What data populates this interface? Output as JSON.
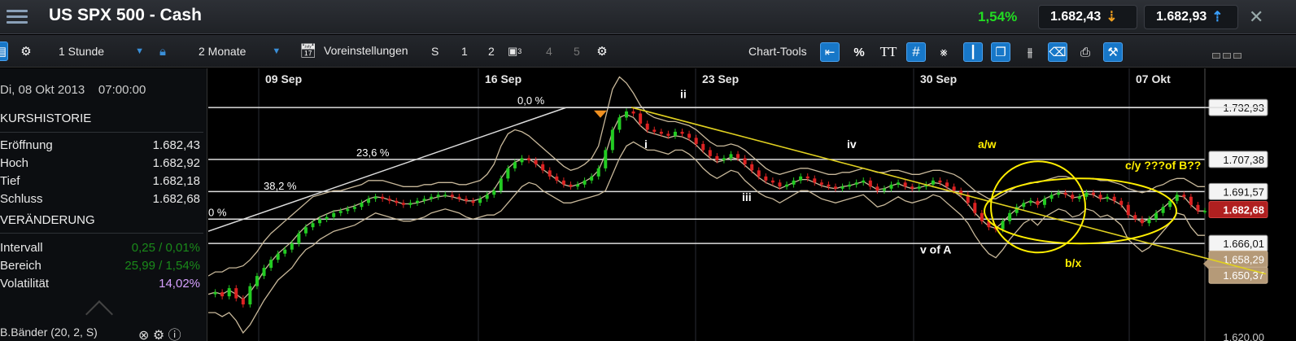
{
  "titlebar": {
    "title": "US SPX 500 - Cash",
    "change": "1,54%",
    "bid": "1.682,43",
    "ask": "1.682,93",
    "icons": [
      "menu-icon",
      "arrow-down-icon",
      "arrow-up-icon",
      "close-icon"
    ]
  },
  "toolbar": {
    "interval": "1 Stunde",
    "range": "2 Monate",
    "presets": "Voreinstellungen",
    "slot_labels": [
      "S",
      "1",
      "2",
      "3",
      "4",
      "5"
    ],
    "chart_tools_label": "Chart-Tools",
    "percent_label": "%",
    "text_label": "TT",
    "icons": [
      "gear-icon",
      "lock-icon",
      "calendar-icon",
      "layout-icon",
      "crosshair-icon",
      "candle-icon",
      "print-icon"
    ]
  },
  "leftpanel": {
    "date": "Di, 08 Okt 2013",
    "time": "07:00:00",
    "kurshistorie": "KURSHISTORIE",
    "rows1": [
      {
        "k": "Eröffnung",
        "v": "1.682,43"
      },
      {
        "k": "Hoch",
        "v": "1.682,92"
      },
      {
        "k": "Tief",
        "v": "1.682,18"
      },
      {
        "k": "Schluss",
        "v": "1.682,68"
      }
    ],
    "veraenderung": "VERÄNDERUNG",
    "rows2": [
      {
        "k": "Intervall",
        "v": "0,25 / 0,01%"
      },
      {
        "k": "Bereich",
        "v": "25,99 / 1,54%"
      },
      {
        "k": "Volatilität",
        "v": "14,02%"
      }
    ],
    "bottom_label": "B.Bänder (20, 2, S)"
  },
  "chart_data": {
    "type": "line",
    "title": "US SPX 500 - Cash",
    "x_ticks": [
      "09 Sep",
      "16 Sep",
      "23 Sep",
      "30 Sep",
      "07 Okt"
    ],
    "y_axis_labels": [
      "1.732,93",
      "1.707,38",
      "1.691,57",
      "1.682,68",
      "1.666,01",
      "1.658,29",
      "1.650,37",
      "1.620,00"
    ],
    "price_levels": [
      1732.93,
      1707.38,
      1691.57,
      1678.0,
      1666.01
    ],
    "current_price": "1.682,68",
    "ylim": [
      1618,
      1745
    ],
    "fib_labels": [
      "0,0 %",
      "23,6 %",
      "38,2 %",
      "0 %"
    ],
    "wave_labels": [
      "i",
      "ii",
      "iii",
      "iv",
      "v of A",
      "a/w",
      "b/x",
      "c/y ???of B??"
    ],
    "price_series": [
      1641,
      1642,
      1640,
      1644,
      1639,
      1636,
      1645,
      1650,
      1654,
      1658,
      1661,
      1663,
      1666,
      1671,
      1674,
      1676,
      1678,
      1679,
      1681,
      1682,
      1683,
      1684,
      1686,
      1688,
      1689,
      1688,
      1687,
      1686,
      1685,
      1686,
      1687,
      1688,
      1689,
      1690,
      1690,
      1689,
      1688,
      1687,
      1686,
      1688,
      1690,
      1692,
      1698,
      1703,
      1706,
      1708,
      1707,
      1705,
      1702,
      1699,
      1697,
      1695,
      1694,
      1695,
      1697,
      1699,
      1703,
      1712,
      1722,
      1728,
      1731,
      1730,
      1725,
      1722,
      1721,
      1720,
      1719,
      1721,
      1720,
      1718,
      1715,
      1712,
      1709,
      1707,
      1708,
      1710,
      1708,
      1705,
      1702,
      1699,
      1697,
      1696,
      1694,
      1695,
      1697,
      1699,
      1698,
      1696,
      1695,
      1694,
      1693,
      1694,
      1695,
      1696,
      1697,
      1694,
      1692,
      1693,
      1695,
      1696,
      1694,
      1693,
      1694,
      1695,
      1697,
      1696,
      1694,
      1692,
      1690,
      1686,
      1681,
      1677,
      1674,
      1673,
      1677,
      1681,
      1684,
      1686,
      1687,
      1685,
      1688,
      1690,
      1691,
      1690,
      1688,
      1689,
      1691,
      1690,
      1688,
      1689,
      1687,
      1685,
      1680,
      1678,
      1676,
      1678,
      1681,
      1684,
      1687,
      1690,
      1689,
      1685,
      1682,
      1682
    ],
    "upper_band": [
      1650,
      1652,
      1652,
      1654,
      1654,
      1655,
      1658,
      1662,
      1667,
      1671,
      1674,
      1677,
      1680,
      1683,
      1686,
      1689,
      1690,
      1691,
      1692,
      1692,
      1693,
      1694,
      1695,
      1697,
      1697,
      1697,
      1696,
      1695,
      1694,
      1694,
      1694,
      1695,
      1695,
      1696,
      1696,
      1696,
      1695,
      1695,
      1696,
      1697,
      1700,
      1705,
      1714,
      1720,
      1722,
      1721,
      1719,
      1716,
      1713,
      1710,
      1707,
      1704,
      1702,
      1703,
      1705,
      1708,
      1714,
      1728,
      1742,
      1748,
      1745,
      1740,
      1734,
      1730,
      1728,
      1727,
      1726,
      1726,
      1725,
      1724,
      1722,
      1719,
      1716,
      1714,
      1714,
      1715,
      1714,
      1712,
      1709,
      1706,
      1703,
      1701,
      1700,
      1701,
      1702,
      1703,
      1703,
      1702,
      1701,
      1700,
      1700,
      1701,
      1701,
      1702,
      1703,
      1702,
      1701,
      1701,
      1702,
      1702,
      1701,
      1700,
      1700,
      1701,
      1702,
      1702,
      1701,
      1700,
      1698,
      1695,
      1692,
      1690,
      1688,
      1688,
      1690,
      1692,
      1694,
      1695,
      1696,
      1696,
      1697,
      1698,
      1699,
      1699,
      1698,
      1698,
      1698,
      1698,
      1697,
      1697,
      1696,
      1695,
      1693,
      1692,
      1691,
      1692,
      1694,
      1695,
      1697,
      1698,
      1698,
      1696,
      1694,
      1694
    ],
    "lower_band": [
      1632,
      1632,
      1630,
      1632,
      1628,
      1622,
      1626,
      1632,
      1638,
      1643,
      1648,
      1651,
      1654,
      1659,
      1663,
      1665,
      1668,
      1670,
      1672,
      1673,
      1674,
      1675,
      1677,
      1679,
      1681,
      1680,
      1679,
      1678,
      1677,
      1677,
      1678,
      1679,
      1681,
      1682,
      1683,
      1682,
      1681,
      1679,
      1678,
      1679,
      1680,
      1680,
      1682,
      1686,
      1690,
      1694,
      1696,
      1695,
      1692,
      1690,
      1688,
      1686,
      1686,
      1687,
      1688,
      1689,
      1690,
      1692,
      1700,
      1708,
      1714,
      1716,
      1714,
      1712,
      1712,
      1711,
      1710,
      1712,
      1712,
      1710,
      1707,
      1703,
      1700,
      1698,
      1700,
      1702,
      1701,
      1697,
      1694,
      1691,
      1689,
      1688,
      1686,
      1688,
      1690,
      1692,
      1692,
      1690,
      1688,
      1687,
      1686,
      1687,
      1688,
      1689,
      1690,
      1687,
      1684,
      1685,
      1687,
      1689,
      1687,
      1686,
      1687,
      1688,
      1690,
      1689,
      1686,
      1683,
      1680,
      1676,
      1670,
      1665,
      1661,
      1659,
      1663,
      1668,
      1672,
      1676,
      1678,
      1675,
      1679,
      1681,
      1683,
      1682,
      1679,
      1680,
      1683,
      1682,
      1679,
      1680,
      1678,
      1675,
      1668,
      1665,
      1662,
      1664,
      1668,
      1672,
      1676,
      1681,
      1680,
      1674,
      1670,
      1670
    ]
  },
  "colors": {
    "up": "#22cc22",
    "down": "#dd2222",
    "band": "#c8b89a",
    "fib": "#dddddd",
    "trend": "#e0d020",
    "annotation": "#ffee00",
    "current_badge": "#b02020",
    "blue_accent": "#1777c8"
  }
}
